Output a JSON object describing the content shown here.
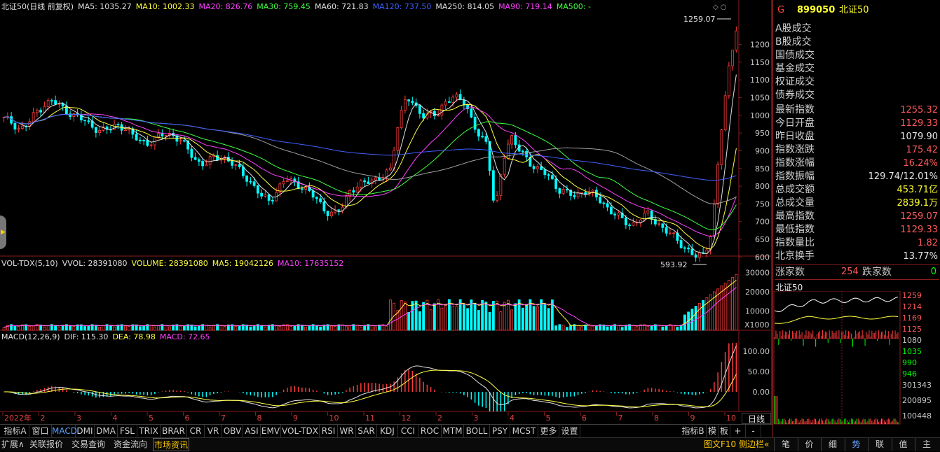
{
  "header": {
    "main_legend": [
      {
        "text": "北证50(日线 前复权)",
        "color": "#e0e0e0"
      },
      {
        "text": "MA5: 1035.27",
        "color": "#e0e0e0"
      },
      {
        "text": "MA10: 1002.33",
        "color": "#ffff40"
      },
      {
        "text": "MA20: 826.76",
        "color": "#ff40ff"
      },
      {
        "text": "MA30: 759.45",
        "color": "#40ff40"
      },
      {
        "text": "MA60: 721.83",
        "color": "#e0e0e0"
      },
      {
        "text": "MA120: 737.50",
        "color": "#4060ff"
      },
      {
        "text": "MA250: 814.05",
        "color": "#e0e0e0"
      },
      {
        "text": "MA90: 719.14",
        "color": "#ff40ff"
      },
      {
        "text": "MA500: -",
        "color": "#40ff40"
      }
    ],
    "vol_legend": [
      {
        "text": "VOL-TDX(5,10)",
        "color": "#e0e0e0"
      },
      {
        "text": "VVOL: 28391080",
        "color": "#e0e0e0"
      },
      {
        "text": "VOLUME: 28391080",
        "color": "#ffff40"
      },
      {
        "text": "MA5: 19042126",
        "color": "#ffff40"
      },
      {
        "text": "MA10: 17635152",
        "color": "#ff40ff"
      }
    ],
    "macd_legend": [
      {
        "text": "MACD(12,26,9)",
        "color": "#e0e0e0"
      },
      {
        "text": "DIF: 115.30",
        "color": "#e0e0e0"
      },
      {
        "text": "DEA: 78.98",
        "color": "#ffff40"
      },
      {
        "text": "MACD: 72.65",
        "color": "#ff40ff"
      }
    ]
  },
  "chart_data": [
    {
      "type": "line",
      "title": "北证50(日线 前复权)",
      "y_ticks": [
        1200,
        1150,
        1100,
        1050,
        1000,
        950,
        900,
        850,
        800,
        750,
        700,
        650,
        600
      ],
      "ylim": [
        575,
        1290
      ],
      "x_labels": [
        "2022年",
        "2",
        "3",
        "4",
        "5",
        "6",
        "7",
        "8",
        "9",
        "10",
        "11",
        "12",
        "2",
        "3",
        "4",
        "5",
        "6",
        "7",
        "8",
        "9",
        "10"
      ],
      "annotations": {
        "high": "1259.07",
        "low": "593.92"
      },
      "close": [
        990,
        980,
        960,
        975,
        1010,
        1030,
        1040,
        1025,
        1010,
        995,
        985,
        970,
        955,
        960,
        975,
        965,
        940,
        930,
        920,
        935,
        950,
        945,
        925,
        900,
        870,
        860,
        880,
        885,
        870,
        850,
        830,
        800,
        770,
        760,
        790,
        820,
        810,
        800,
        780,
        760,
        730,
        720,
        740,
        790,
        800,
        810,
        820,
        830,
        840,
        980,
        1060,
        1020,
        1000,
        1010,
        1000,
        1040,
        1060,
        1040,
        990,
        950,
        920,
        720,
        880,
        940,
        900,
        880,
        850,
        840,
        820,
        790,
        780,
        770,
        790,
        780,
        760,
        740,
        720,
        700,
        690,
        710,
        720,
        700,
        680,
        660,
        640,
        620,
        600,
        605,
        680,
        930,
        1120,
        1250
      ]
    },
    {
      "type": "bar",
      "title": "VOL-TDX(5,10)",
      "y_ticks": [
        30000,
        20000,
        10000
      ],
      "unit": "X1000"
    },
    {
      "type": "bar",
      "title": "MACD(12,26,9)",
      "y_ticks": [
        100,
        50,
        0
      ]
    }
  ],
  "x_axis": {
    "labels": [
      "2022年",
      "2",
      "3",
      "4",
      "5",
      "6",
      "7",
      "8",
      "9",
      "10",
      "11",
      "12",
      "2",
      "3",
      "4",
      "5",
      "6",
      "7",
      "8",
      "9",
      "10"
    ]
  },
  "right_panel": {
    "code_letter": "G",
    "code": "899050",
    "name": "北证50",
    "menu": [
      "A股成交",
      "B股成交",
      "国债成交",
      "基金成交",
      "权证成交",
      "债券成交"
    ],
    "stats": [
      {
        "label": "最新指数",
        "value": "1255.32",
        "cls": "red"
      },
      {
        "label": "今日开盘",
        "value": "1129.33",
        "cls": "red"
      },
      {
        "label": "昨日收盘",
        "value": "1079.90",
        "cls": "white"
      },
      {
        "label": "指数涨跌",
        "value": "175.42",
        "cls": "red"
      },
      {
        "label": "指数涨幅",
        "value": "16.24%",
        "cls": "red"
      },
      {
        "label": "指数振幅",
        "value": "129.74/12.01%",
        "cls": "white"
      },
      {
        "label": "总成交额",
        "value": "453.71亿",
        "cls": "yellow"
      },
      {
        "label": "总成交量",
        "value": "2839.1万",
        "cls": "yellow"
      },
      {
        "label": "最高指数",
        "value": "1259.07",
        "cls": "red"
      },
      {
        "label": "最低指数",
        "value": "1129.33",
        "cls": "red"
      },
      {
        "label": "指数量比",
        "value": "1.82",
        "cls": "red"
      },
      {
        "label": "北京换手",
        "value": "13.77%",
        "cls": "white"
      }
    ],
    "rise_label": "涨家数",
    "rise_value": "254",
    "fall_label": "跌家数",
    "fall_value": "0",
    "mini_title": "北证50",
    "mini_ticks": [
      "1259",
      "1214",
      "1169",
      "1125",
      "1080",
      "1035",
      "990",
      "946",
      "301343",
      "200895",
      "100448"
    ]
  },
  "tabs": [
    "指标A",
    "窗口",
    "MACD",
    "DMI",
    "DMA",
    "FSL",
    "TRIX",
    "BRAR",
    "CR",
    "VR",
    "OBV",
    "ASI",
    "EMV",
    "VOL-TDX",
    "RSI",
    "WR",
    "SAR",
    "KDJ",
    "CCI",
    "ROC",
    "MTM",
    "BOLL",
    "PSY",
    "MCST",
    "更多",
    "设置"
  ],
  "right_tabs": [
    "指标B",
    "模",
    "板",
    "+",
    "-"
  ],
  "daily_label": "日线",
  "status_left": [
    "扩展∧",
    "关联报价",
    "交易查询",
    "资金流向",
    "市场资讯"
  ],
  "status_right": [
    "图文F10",
    "侧边栏«"
  ],
  "status_tabs": [
    "笔",
    "价",
    "细",
    "势",
    "联",
    "值",
    "主"
  ],
  "colors": {
    "up": "#ff3b3b",
    "down": "#00ffff",
    "ma5": "#e0e0e0",
    "ma10": "#ffff40",
    "ma20": "#ff40ff",
    "ma30": "#40ff40",
    "ma120": "#4060ff"
  }
}
